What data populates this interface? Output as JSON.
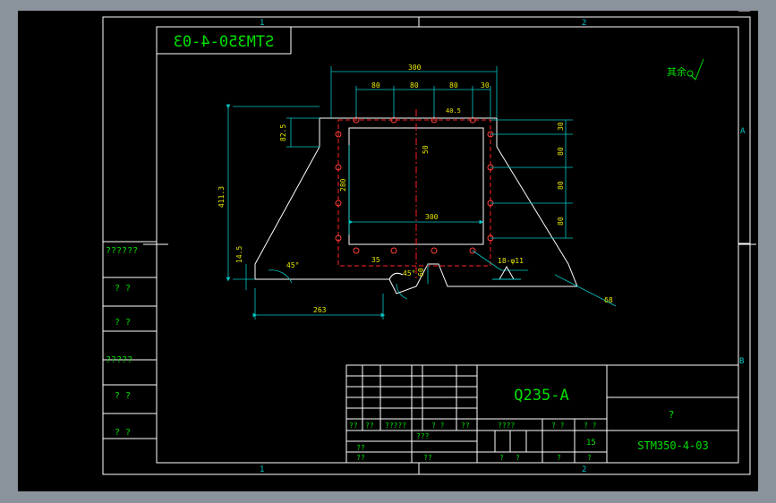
{
  "colors": {
    "background": "#000000",
    "frame": "#ffffff",
    "border": "#00c8c8",
    "dimension": "#00c8c8",
    "title_text": "#00e000",
    "centerline": "#ff2020",
    "hole": "#ff4040",
    "surround": "#8a929c"
  },
  "zones": {
    "top_left": "1",
    "top_right": "2",
    "bottom_left": "1",
    "bottom_right": "2",
    "right_a": "A",
    "right_b": "B"
  },
  "mirrored_code": "STM350-4-03",
  "roughness": "其余",
  "dimensions": {
    "overall_width": "300",
    "spacing_1": "80",
    "spacing_2": "80",
    "spacing_3": "80",
    "spacing_4": "30",
    "top_offset": "40.5",
    "right_1": "30",
    "right_2": "80",
    "right_3": "80",
    "right_4": "80",
    "height_left": "82.5",
    "total_height": "411.3",
    "inner_height": "280",
    "inner_width": "300",
    "vertical_mid": "50",
    "base_height": "14.5",
    "angle_left": "45°",
    "slot": "35",
    "slot_angle": "45°",
    "slot_depth": "60",
    "hole_callout": "18-φ11",
    "thickness": "δ8",
    "base_width": "263"
  },
  "side_labels": [
    "??????",
    "? ?",
    "? ?",
    "?????",
    "? ?",
    "? ?"
  ],
  "title_block": {
    "material": "Q235-A",
    "part_name": "?",
    "drawing_no": "STM350-4-03",
    "row_labels": [
      "??",
      "??",
      "?????",
      "? ?",
      "??"
    ],
    "row2": [
      "??",
      "???"
    ],
    "row3": [
      "??"
    ],
    "row4": [
      "??",
      "??"
    ],
    "stage_header": "????",
    "weight_header": "? ?",
    "scale_header": "? ?",
    "scale": "15",
    "bottom_row": [
      "?",
      "?",
      "?",
      "?"
    ]
  }
}
